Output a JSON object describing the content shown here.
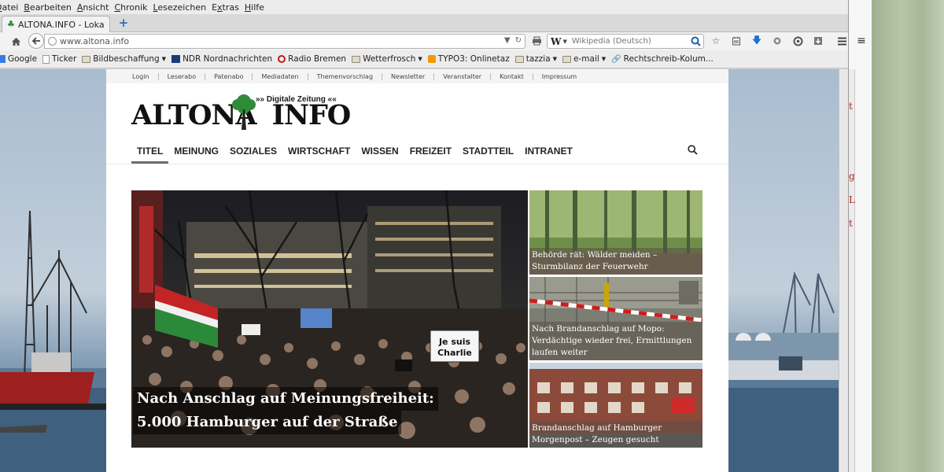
{
  "browser": {
    "menu": [
      {
        "pre": "",
        "u": "D",
        "post": "atei"
      },
      {
        "pre": "",
        "u": "B",
        "post": "earbeiten"
      },
      {
        "pre": "",
        "u": "A",
        "post": "nsicht"
      },
      {
        "pre": "",
        "u": "C",
        "post": "hronik"
      },
      {
        "pre": "",
        "u": "L",
        "post": "esezeichen"
      },
      {
        "pre": "E",
        "u": "x",
        "post": "tras"
      },
      {
        "pre": "",
        "u": "H",
        "post": "ilfe"
      }
    ],
    "tab": {
      "title": "ALTONA.INFO - Lokal..."
    },
    "url": "www.altona.info",
    "search": {
      "engine_icon": "W",
      "placeholder": "Wikipedia (Deutsch)"
    },
    "bookmarks": [
      {
        "label": "Google",
        "icon": "google-icon",
        "folder": false
      },
      {
        "label": "Ticker",
        "icon": "page-icon",
        "folder": false
      },
      {
        "label": "Bildbeschaffung",
        "icon": "folder-icon",
        "folder": true
      },
      {
        "label": "NDR Nordnachrichten",
        "icon": "ndr-icon",
        "folder": false
      },
      {
        "label": "Radio Bremen",
        "icon": "rb-icon",
        "folder": false
      },
      {
        "label": "Wetterfrosch",
        "icon": "folder-icon",
        "folder": true
      },
      {
        "label": "TYPO3: Onlinetaz",
        "icon": "typo-icon",
        "folder": false
      },
      {
        "label": "tazzia",
        "icon": "folder-icon",
        "folder": true
      },
      {
        "label": "e-mail",
        "icon": "folder-icon",
        "folder": true
      },
      {
        "label": "Rechtschreib-Kolum...",
        "icon": "link-icon",
        "folder": false
      }
    ]
  },
  "site": {
    "topnav": [
      "Login",
      "Leserabo",
      "Patenabo",
      "Mediadaten",
      "Themenvorschlag",
      "Newsletter",
      "Veranstalter",
      "Kontakt",
      "Impressum"
    ],
    "logo": {
      "name": "ALTONA INFO",
      "tagline": "»» Digitale Zeitung ««"
    },
    "mainnav": [
      "TITEL",
      "MEINUNG",
      "SOZIALES",
      "WIRTSCHAFT",
      "WISSEN",
      "FREIZEIT",
      "STADTTEIL",
      "INTRANET"
    ],
    "mainnav_active": "TITEL",
    "hero": {
      "caption_line1": "Nach Anschlag auf Meinungsfreiheit:",
      "caption_line2": "5.000 Hamburger auf der Straße",
      "sign_text_1": "Je suis",
      "sign_text_2": "Charlie"
    },
    "side_articles": [
      {
        "title": "Behörde rät: Wälder meiden – Sturmbilanz der Feuerwehr"
      },
      {
        "title": "Nach Brandanschlag auf Mopo: Verdächtige wieder frei, Ermittlungen laufen weiter"
      },
      {
        "title": "Brandanschlag auf Hamburger Morgenpost – Zeugen gesucht"
      }
    ]
  },
  "right_pane": {
    "link_fragments": [
      "t",
      "g",
      "L",
      "t"
    ]
  }
}
